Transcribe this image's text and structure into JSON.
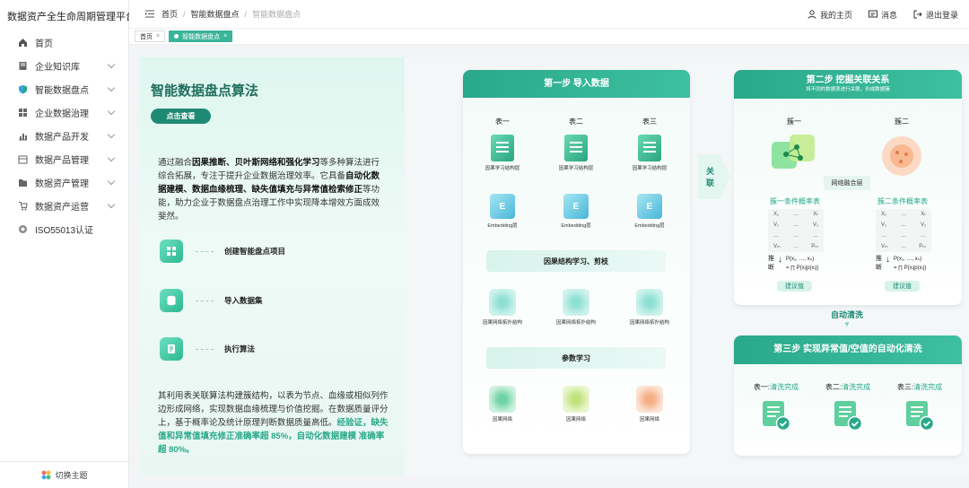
{
  "app": {
    "title": "数据资产全生命周期管理平台"
  },
  "sidebar": {
    "items": [
      {
        "label": "首页",
        "icon": "home-icon",
        "has_children": false
      },
      {
        "label": "企业知识库",
        "icon": "book-icon",
        "has_children": true
      },
      {
        "label": "智能数据盘点",
        "icon": "shield-icon",
        "has_children": true
      },
      {
        "label": "企业数据治理",
        "icon": "grid-icon",
        "has_children": true
      },
      {
        "label": "数据产品开发",
        "icon": "chart-icon",
        "has_children": true
      },
      {
        "label": "数据产品管理",
        "icon": "box-icon",
        "has_children": true
      },
      {
        "label": "数据资产管理",
        "icon": "folder-icon",
        "has_children": true
      },
      {
        "label": "数据资产运营",
        "icon": "cart-icon",
        "has_children": true
      },
      {
        "label": "ISO55013认证",
        "icon": "cert-icon",
        "has_children": false
      }
    ],
    "footer": "切换主题"
  },
  "header": {
    "breadcrumb": [
      "首页",
      "智能数据盘点",
      "智能数据盘点"
    ],
    "actions": {
      "home": "我的主页",
      "message": "消息",
      "logout": "退出登录"
    }
  },
  "tabs": [
    {
      "label": "首页"
    },
    {
      "label": "智能数据盘点"
    }
  ],
  "left": {
    "title": "智能数据盘点算法",
    "button": "点击查看",
    "desc": [
      {
        "t": "通过融合",
        "b": false
      },
      {
        "t": "因果推断、贝叶斯网络和强化学习",
        "b": true
      },
      {
        "t": "等多种算法进行综合拓展，专注于提升企业数据治理效率。它具备",
        "b": false
      },
      {
        "t": "自动化数据建模、数据血缘梳理、缺失值填充与异常值检索修正",
        "b": true
      },
      {
        "t": "等功能，助力企业于数据盘点治理工作中实现降本增效方面成效斐然。",
        "b": false
      }
    ],
    "steps": [
      "创建智能盘点项目",
      "导入数据集",
      "执行算法"
    ],
    "desc2": "其利用表关联算法构建簇结构，以表为节点、血缘或相似列作边形成网络，实现数据血缘梳理与价值挖掘。在数据质量评分上，基于概率论及统计原理判断数据质量高低。",
    "desc2_hl": "经验证，缺失值和异常值填充修正准确率超 85%，自动化数据建模 准确率超 80%。"
  },
  "step1": {
    "title": "第一步 导入数据",
    "tables": [
      "表一",
      "表二",
      "表三"
    ],
    "layer1": [
      "因果学习结构层",
      "因果学习结构层",
      "因果学习结构层"
    ],
    "layer2": [
      "Embedding层",
      "Embedding层",
      "Embedding层"
    ],
    "phase1": "因果结构学习、剪枝",
    "layer3": [
      "因果网络拓扑结构",
      "因果网络拓扑结构",
      "因果网络拓扑结构"
    ],
    "phase2": "参数学习",
    "layer4": [
      "因果网络",
      "因果网络",
      "因果网络"
    ]
  },
  "link_label": [
    "关",
    "联"
  ],
  "step2": {
    "title": "第二步 挖掘关联关系",
    "subtitle": "将不同的数据表进行关联，形成数据簇",
    "clusters": [
      "簇一",
      "簇二"
    ],
    "fusion": "网络融合层",
    "cpt1": "簇一条件概率表",
    "cpt2": "簇二条件概率表",
    "cpt_rows": [
      [
        "X₁",
        "…",
        "Xₜ"
      ],
      [
        "V₁",
        "…",
        "V₁"
      ],
      [
        "…",
        "…",
        "…"
      ],
      [
        "Vₘ",
        "…",
        "Pₘ"
      ]
    ],
    "infer_label": [
      "推",
      "断"
    ],
    "formula1": "P(x₁, …, xₙ)",
    "formula2": "= ∏ P(xᵢ|p(xᵢ))",
    "suggest": "建议值"
  },
  "auto_clean": "自动清洗",
  "step3": {
    "title": "第三步 实现异常值/空值的自动化清洗",
    "items": [
      {
        "table": "表一:",
        "status": "清洗完成"
      },
      {
        "table": "表二:",
        "status": "清洗完成"
      },
      {
        "table": "表三:",
        "status": "清洗完成"
      }
    ]
  },
  "colors": {
    "accent": "#2aa98a",
    "accent_dark": "#1f6e5c"
  }
}
